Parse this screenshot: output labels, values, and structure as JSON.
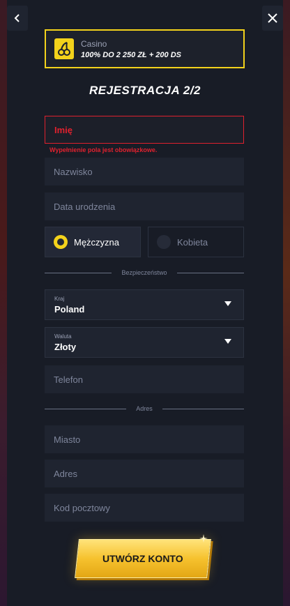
{
  "bonus": {
    "label": "Casino",
    "offer": "100% DO 2 250 ZŁ + 200 DS"
  },
  "page": {
    "title": "REJESTRACJA 2/2"
  },
  "form": {
    "first_name": {
      "placeholder": "Imię",
      "error": "Wypełnienie pola jest obowiązkowe."
    },
    "last_name": {
      "placeholder": "Nazwisko"
    },
    "birth_date": {
      "placeholder": "Data urodzenia"
    },
    "gender": {
      "male": {
        "label": "Mężczyzna",
        "selected": true
      },
      "female": {
        "label": "Kobieta",
        "selected": false
      }
    },
    "section_security": "Bezpieczeństwo",
    "country": {
      "label": "Kraj",
      "value": "Poland"
    },
    "currency": {
      "label": "Waluta",
      "value": "Złoty"
    },
    "phone": {
      "placeholder": "Telefon"
    },
    "section_address": "Adres",
    "city": {
      "placeholder": "Miasto"
    },
    "address": {
      "placeholder": "Adres"
    },
    "postal_code": {
      "placeholder": "Kod pocztowy"
    }
  },
  "cta": {
    "label": "UTWÓRZ KONTO"
  },
  "colors": {
    "accent": "#f3d21b",
    "error": "#e0212e",
    "panel": "#181c26",
    "field": "#1f2430"
  },
  "icons": {
    "back": "chevron-left-icon",
    "close": "close-icon",
    "bonus": "cherries-icon"
  }
}
